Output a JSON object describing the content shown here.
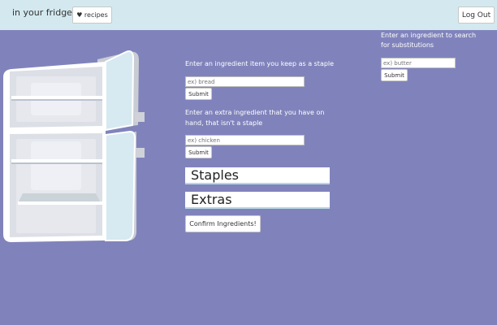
{
  "nav": {
    "brand": "in your fridge",
    "recipes_label": "♥ recipes",
    "logout_label": "Log Out"
  },
  "staple": {
    "label": "Enter an ingredient item you keep as a staple",
    "placeholder": "ex) bread",
    "submit_label": "Submit"
  },
  "extra": {
    "label_line1": "Enter an extra ingredient that you have on",
    "label_line2": "hand, that isn't a staple",
    "placeholder": "ex) chicken",
    "submit_label": "Submit"
  },
  "lists": {
    "staples_heading": "Staples",
    "extras_heading": "Extras"
  },
  "confirm_label": "Confirm Ingredients!",
  "substitution": {
    "label_line1": "Enter an ingredient to search",
    "label_line2": "for substitutions",
    "placeholder": "ex) butter",
    "submit_label": "Submit"
  },
  "colors": {
    "background": "#8083bb",
    "topbar": "#d3e9ef",
    "accent": "#b9d7e3"
  }
}
